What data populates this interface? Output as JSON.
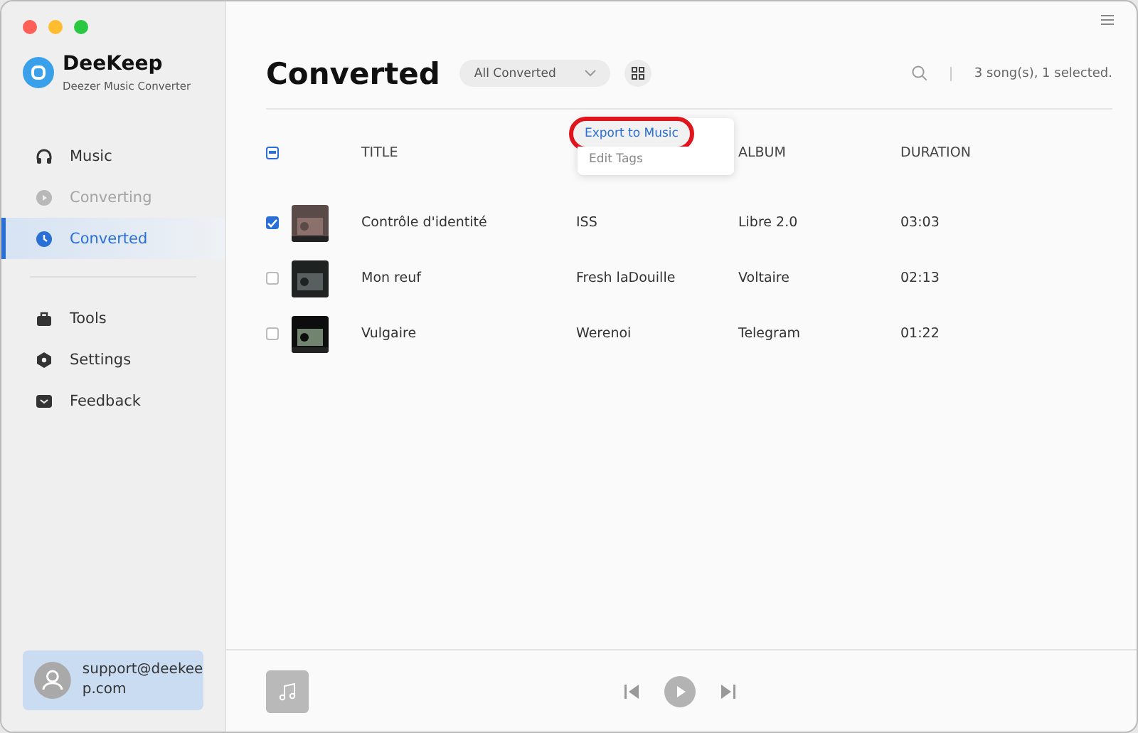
{
  "app": {
    "name": "DeeKeep",
    "subtitle": "Deezer Music Converter"
  },
  "sidebar": {
    "items": [
      {
        "label": "Music",
        "selected": false,
        "disabled": false
      },
      {
        "label": "Converting",
        "selected": false,
        "disabled": true
      },
      {
        "label": "Converted",
        "selected": true,
        "disabled": false
      }
    ],
    "tools": [
      {
        "label": "Tools"
      },
      {
        "label": "Settings"
      },
      {
        "label": "Feedback"
      }
    ],
    "account": "support@deekeep.com"
  },
  "header": {
    "title": "Converted",
    "filter": "All Converted",
    "status": "3 song(s), 1 selected."
  },
  "menu": {
    "items": [
      {
        "label": "Export to Music",
        "selected": true,
        "highlighted": true
      },
      {
        "label": "Edit Tags",
        "selected": false,
        "highlighted": false
      }
    ]
  },
  "table": {
    "select_all_partial": true,
    "columns": [
      "TITLE",
      "ALBUM",
      "DURATION"
    ],
    "rows": [
      {
        "checked": true,
        "title": "Contrôle d'identité",
        "artist": "ISS",
        "album": "Libre 2.0",
        "duration": "03:03"
      },
      {
        "checked": false,
        "title": "Mon reuf",
        "artist": "Fresh laDouille",
        "album": "Voltaire",
        "duration": "02:13"
      },
      {
        "checked": false,
        "title": "Vulgaire",
        "artist": "Werenoi",
        "album": "Telegram",
        "duration": "01:22"
      }
    ]
  }
}
